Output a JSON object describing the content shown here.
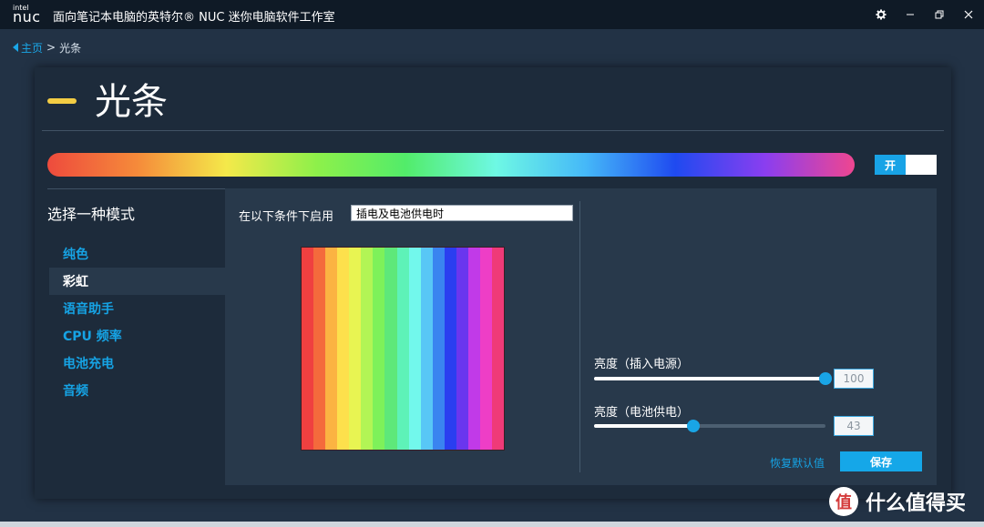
{
  "titlebar": {
    "logo_intel": "intel",
    "logo_nuc": "nuc",
    "title": "面向笔记本电脑的英特尔® NUC 迷你电脑软件工作室",
    "icons": [
      "gear-icon",
      "minimize-icon",
      "restore-icon",
      "close-icon"
    ]
  },
  "breadcrumb": {
    "home": "主页",
    "separator": ">",
    "current": "光条"
  },
  "page": {
    "title": "光条",
    "accent": "#f3cd44"
  },
  "rainbow_colors": [
    "#ee4b3d",
    "#f58a3a",
    "#f4e94a",
    "#8ef04a",
    "#52ec6a",
    "#6ef8e4",
    "#45b8f8",
    "#1f4af0",
    "#8a3ef0",
    "#ef4690"
  ],
  "toggle": {
    "label": "开",
    "state": "on"
  },
  "sidebar": {
    "title": "选择一种模式",
    "items": [
      {
        "label": "纯色",
        "active": false
      },
      {
        "label": "彩虹",
        "active": true
      },
      {
        "label": "语音助手",
        "active": false
      },
      {
        "label": "CPU 频率",
        "active": false
      },
      {
        "label": "电池充电",
        "active": false
      },
      {
        "label": "音频",
        "active": false
      }
    ]
  },
  "condition": {
    "label": "在以下条件下启用",
    "value": "插电及电池供电时"
  },
  "preview_stripes": [
    "#ef4040",
    "#f46a3c",
    "#fbb342",
    "#fde04c",
    "#e8f452",
    "#b2f555",
    "#7ef15a",
    "#5ee87a",
    "#5ef2b8",
    "#72f8ec",
    "#58c7f6",
    "#3a84f0",
    "#2a3ef0",
    "#6a36ee",
    "#c13ae8",
    "#ee3ec6",
    "#ef3a78"
  ],
  "brightness_plugged": {
    "label": "亮度（插入电源）",
    "value": 100,
    "value_text": "100"
  },
  "brightness_battery": {
    "label": "亮度（电池供电）",
    "value": 43,
    "value_text": "43"
  },
  "actions": {
    "reset": "恢复默认值",
    "save": "保存"
  },
  "watermark": {
    "badge": "值",
    "text": "什么值得买"
  },
  "colors": {
    "accent_blue": "#16a3e4",
    "background": "#223245"
  }
}
